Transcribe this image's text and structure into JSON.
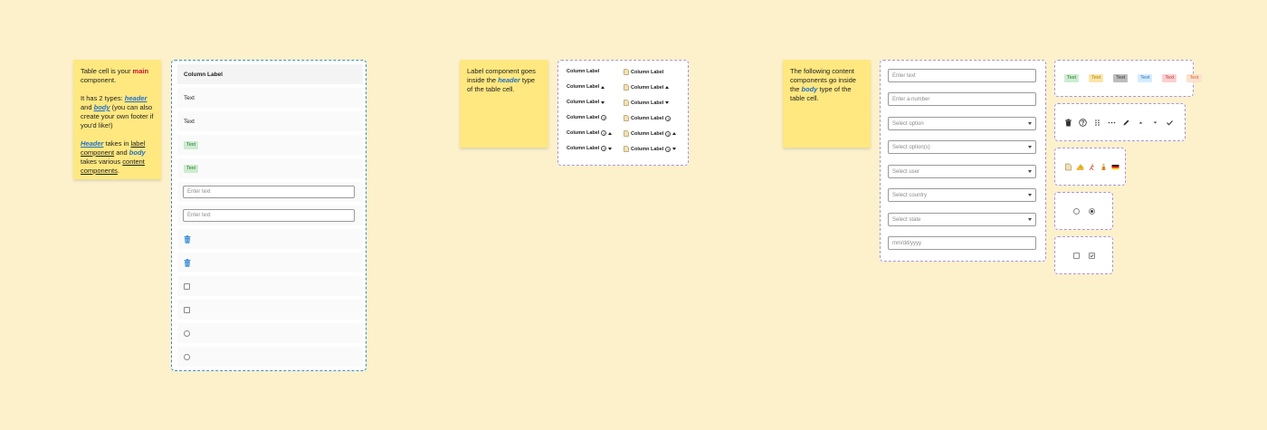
{
  "note1": {
    "p1_before": "Table cell is your ",
    "p1_strong": "main",
    "p1_after": " component.",
    "p2_before": "It has 2 types: ",
    "p2_header": "header",
    "p2_and": " and ",
    "p2_body": "body",
    "p2_after": " (you can also create your own footer if you'd like!)",
    "p3_header": "Header",
    "p3_takes": " takes in ",
    "p3_label": "label component",
    "p3_and": " and ",
    "p3_body": "body",
    "p3_takes2": " takes various ",
    "p3_content": "content components",
    "p3_dot": "."
  },
  "note2": {
    "before": "Label component goes inside the ",
    "header": "header",
    "after": " type of the table cell."
  },
  "note3": {
    "before": "The following content components go inside the ",
    "body": "body",
    "after": " type of the table cell."
  },
  "table_cells": {
    "header_label": "Column Label",
    "text1": "Text",
    "text2": "Text",
    "tag1": "Text",
    "tag2": "Text",
    "input1_placeholder": "Enter text",
    "input2_placeholder": "Enter text"
  },
  "labels": {
    "column_label": "Column Label",
    "question_mark": "?"
  },
  "content": {
    "text_input": "Enter text",
    "number_input": "Enter a number",
    "select_option": "Select option",
    "select_options": "Select option(s)",
    "select_user": "Select user",
    "select_country": "Select country",
    "select_state": "Select state",
    "date_input": "mm/dd/yyyy"
  },
  "tags": [
    "Text",
    "Text",
    "Text",
    "Text",
    "Text",
    "Text"
  ],
  "colors": {
    "background": "#fcf1cb",
    "sticky": "#ffe880",
    "accent_blue": "#1f6fc9",
    "accent_red": "#c8102e"
  }
}
